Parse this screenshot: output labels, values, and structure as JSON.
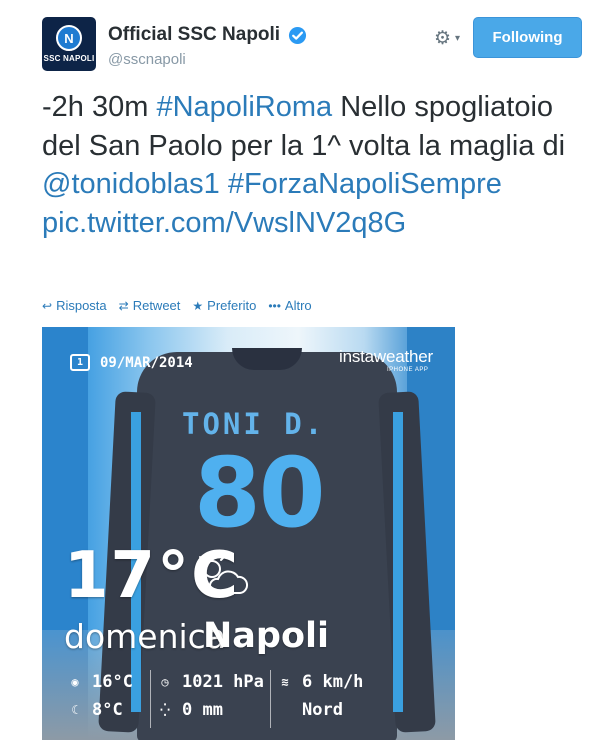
{
  "tweet": {
    "author": {
      "display_name": "Official SSC Napoli",
      "handle": "@sscnapoli",
      "avatar_text": "SSC NAPOLI",
      "avatar_badge": "N",
      "verified": true
    },
    "follow_button_label": "Following",
    "text_parts": {
      "p1": "-2h 30m ",
      "hashtag1": "#NapoliRoma",
      "p2": " Nello spogliatoio del San Paolo per la 1^ volta la maglia di ",
      "mention": "@tonidoblas1",
      "hashtag2": "#ForzaNapoliSempre",
      "link": "pic.twitter.com/VwslNV2q8G"
    },
    "actions": {
      "reply": "Risposta",
      "retweet": "Retweet",
      "favorite": "Preferito",
      "more": "Altro"
    }
  },
  "photo": {
    "date": "09/MAR/2014",
    "brand": "instaweather",
    "brand_sub": "IPHONE APP",
    "shirt_name": "TONI D.",
    "shirt_number": "80",
    "temperature": "17°C",
    "day": "domenica",
    "city": "Napoli",
    "stats": {
      "high": "16°C",
      "low": "8°C",
      "pressure": "1021 hPa",
      "rain": "0 mm",
      "wind_speed": "6 km/h",
      "wind_dir": "Nord"
    }
  },
  "icons": {
    "gear": "gear-icon",
    "caret": "chevron-down-icon",
    "verified": "verified-badge-icon",
    "reply": "reply-icon",
    "retweet": "retweet-icon",
    "favorite": "star-icon",
    "more": "more-dots-icon"
  },
  "colors": {
    "follow_button": "#4aa8e8",
    "link": "#2b7bb9",
    "text": "#292f33",
    "muted": "#8899a6"
  }
}
